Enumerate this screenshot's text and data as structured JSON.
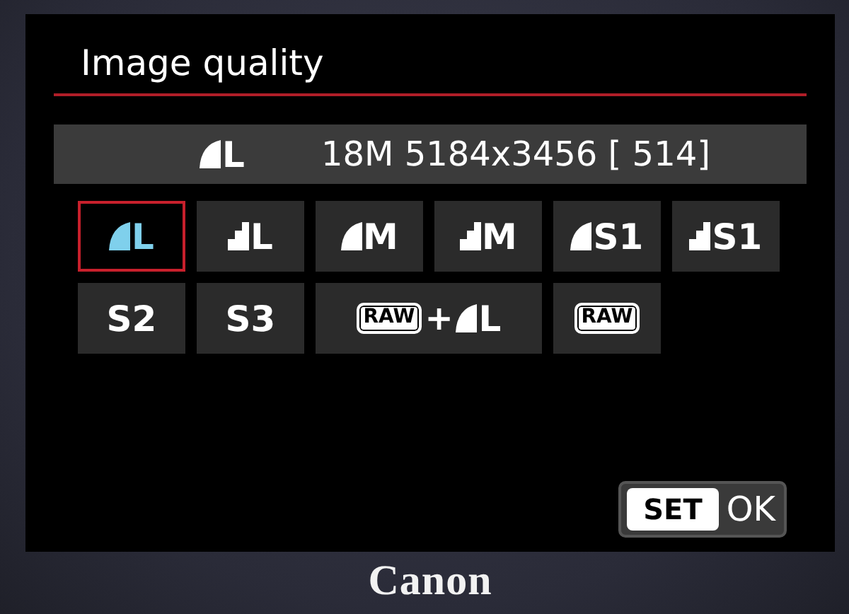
{
  "screen": {
    "title": "Image quality",
    "current": {
      "mark": {
        "kind": "fine"
      },
      "size": "L",
      "details": "18M 5184x3456 [ 514]"
    },
    "options": [
      {
        "kind": "jpeg",
        "mark": {
          "kind": "fine"
        },
        "size": "L",
        "selected": true
      },
      {
        "kind": "jpeg",
        "mark": {
          "kind": "normal"
        },
        "size": "L",
        "selected": false
      },
      {
        "kind": "jpeg",
        "mark": {
          "kind": "fine"
        },
        "size": "M",
        "selected": false
      },
      {
        "kind": "jpeg",
        "mark": {
          "kind": "normal"
        },
        "size": "M",
        "selected": false
      },
      {
        "kind": "jpeg",
        "mark": {
          "kind": "fine"
        },
        "size": "S1",
        "selected": false
      },
      {
        "kind": "jpeg",
        "mark": {
          "kind": "normal"
        },
        "size": "S1",
        "selected": false
      },
      {
        "kind": "jpeg",
        "size": "S2",
        "selected": false
      },
      {
        "kind": "jpeg",
        "size": "S3",
        "selected": false
      },
      {
        "kind": "raw_jpeg",
        "raw_label": "RAW",
        "joiner": "+",
        "mark": {
          "kind": "fine"
        },
        "size": "L",
        "selected": false
      },
      {
        "kind": "raw",
        "raw_label": "RAW",
        "selected": false
      }
    ],
    "set_button": {
      "key": "SET",
      "label": "OK"
    }
  },
  "brand": "Canon"
}
